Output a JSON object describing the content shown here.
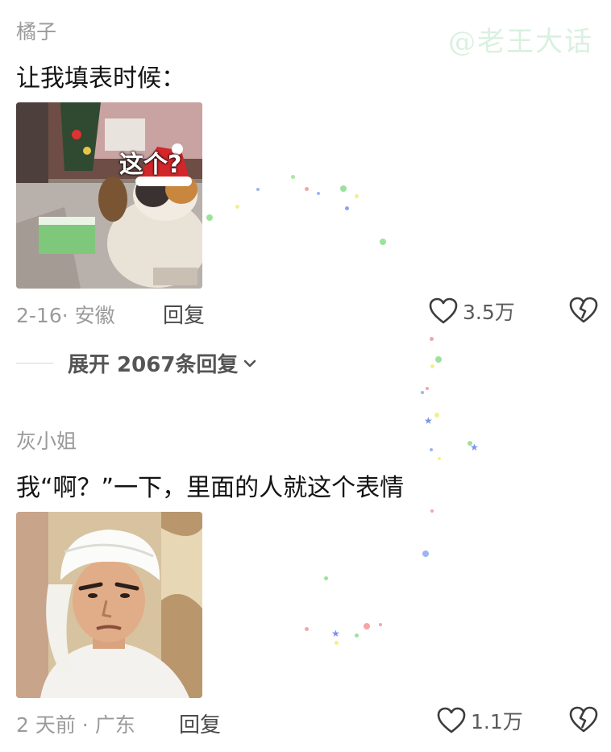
{
  "watermark": "@老王大话",
  "comments": [
    {
      "username": "橘子",
      "text": "让我填表时候：",
      "image_caption": "这个?",
      "meta": "2-16· 安徽",
      "reply_label": "回复",
      "likes": "3.5万",
      "image_icon": "cat-in-santa-hat-gif"
    },
    {
      "username": "灰小姐",
      "text": "我“啊？”一下，里面的人就这个表情",
      "meta": "2 天前 · 广东",
      "reply_label": "回复",
      "likes": "1.1万",
      "image_icon": "man-with-towel-gif"
    }
  ],
  "expand_replies": "展开 2067条回复",
  "icons": {
    "like": "heart-outline-icon",
    "dislike": "broken-heart-icon",
    "expand": "chevron-down-icon"
  },
  "colors": {
    "username": "#9a9a9a",
    "text": "#141414",
    "meta": "#9b9b9b",
    "watermark": "#d9f1df"
  }
}
